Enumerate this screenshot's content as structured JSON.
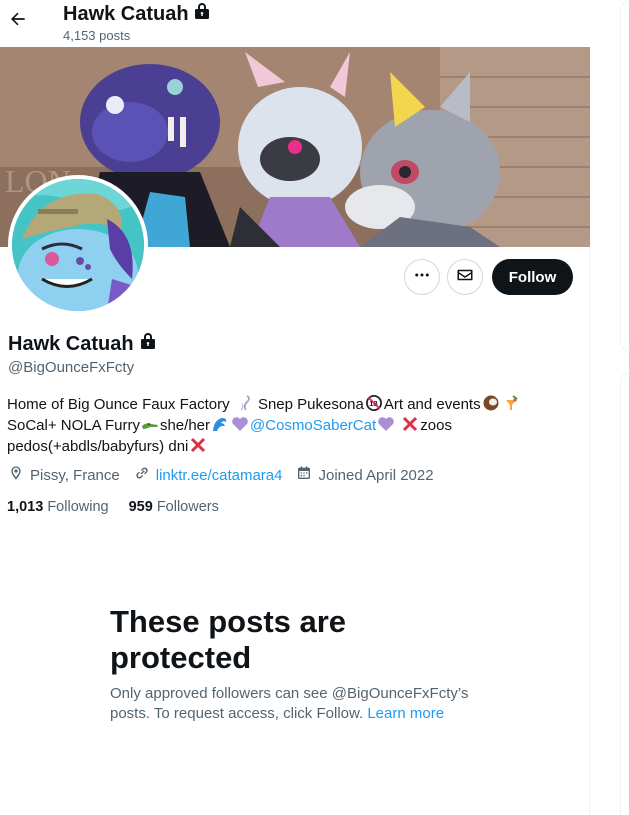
{
  "header": {
    "name": "Hawk Catuah",
    "posts": "4,153 posts"
  },
  "profile": {
    "display_name": "Hawk Catuah",
    "handle": "@BigOunceFxFcty",
    "follow_label": "Follow",
    "bio": {
      "part1": "Home of Big Ounce Faux Factory",
      "part2": "Snep Pukesona",
      "part3": "Art and events",
      "part4": "SoCal+ NOLA Furry",
      "part5": "she/her",
      "mention": "@CosmoSaberCat",
      "part6": "zoos",
      "part7": "pedos(+abdls/babyfurs) dni"
    },
    "location": "Pissy, France",
    "website": "linktr.ee/catamara4",
    "joined": "Joined April 2022",
    "following_count": "1,013",
    "following_label": "Following",
    "followers_count": "959",
    "followers_label": "Followers"
  },
  "protected": {
    "title": "These posts are protected",
    "text": "Only approved followers can see @BigOunceFxFcty’s posts. To request access, click Follow.",
    "learn_more": "Learn more"
  },
  "icons": {
    "back": "arrow-left-icon",
    "lock": "lock-icon",
    "more": "more-horizontal-icon",
    "message": "envelope-icon",
    "location": "location-pin-icon",
    "link": "link-icon",
    "calendar": "calendar-icon"
  },
  "colors": {
    "accent": "#1d9bf0",
    "text": "#0f1419",
    "muted": "#536471",
    "button_dark": "#0f1419"
  }
}
